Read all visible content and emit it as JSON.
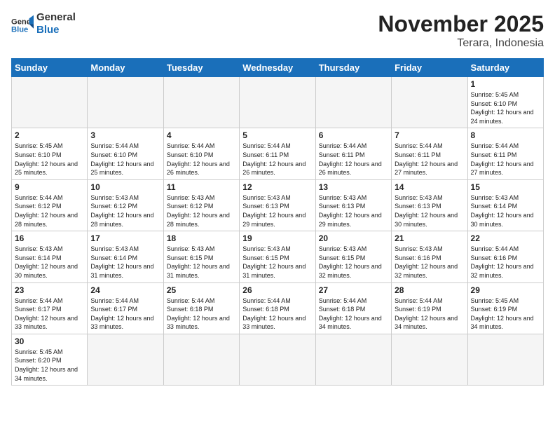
{
  "header": {
    "logo_general": "General",
    "logo_blue": "Blue",
    "title": "November 2025",
    "subtitle": "Terara, Indonesia"
  },
  "weekdays": [
    "Sunday",
    "Monday",
    "Tuesday",
    "Wednesday",
    "Thursday",
    "Friday",
    "Saturday"
  ],
  "weeks": [
    [
      {
        "day": "",
        "info": ""
      },
      {
        "day": "",
        "info": ""
      },
      {
        "day": "",
        "info": ""
      },
      {
        "day": "",
        "info": ""
      },
      {
        "day": "",
        "info": ""
      },
      {
        "day": "",
        "info": ""
      },
      {
        "day": "1",
        "info": "Sunrise: 5:45 AM\nSunset: 6:10 PM\nDaylight: 12 hours and 24 minutes."
      }
    ],
    [
      {
        "day": "2",
        "info": "Sunrise: 5:45 AM\nSunset: 6:10 PM\nDaylight: 12 hours and 25 minutes."
      },
      {
        "day": "3",
        "info": "Sunrise: 5:44 AM\nSunset: 6:10 PM\nDaylight: 12 hours and 25 minutes."
      },
      {
        "day": "4",
        "info": "Sunrise: 5:44 AM\nSunset: 6:10 PM\nDaylight: 12 hours and 26 minutes."
      },
      {
        "day": "5",
        "info": "Sunrise: 5:44 AM\nSunset: 6:11 PM\nDaylight: 12 hours and 26 minutes."
      },
      {
        "day": "6",
        "info": "Sunrise: 5:44 AM\nSunset: 6:11 PM\nDaylight: 12 hours and 26 minutes."
      },
      {
        "day": "7",
        "info": "Sunrise: 5:44 AM\nSunset: 6:11 PM\nDaylight: 12 hours and 27 minutes."
      },
      {
        "day": "8",
        "info": "Sunrise: 5:44 AM\nSunset: 6:11 PM\nDaylight: 12 hours and 27 minutes."
      }
    ],
    [
      {
        "day": "9",
        "info": "Sunrise: 5:44 AM\nSunset: 6:12 PM\nDaylight: 12 hours and 28 minutes."
      },
      {
        "day": "10",
        "info": "Sunrise: 5:43 AM\nSunset: 6:12 PM\nDaylight: 12 hours and 28 minutes."
      },
      {
        "day": "11",
        "info": "Sunrise: 5:43 AM\nSunset: 6:12 PM\nDaylight: 12 hours and 28 minutes."
      },
      {
        "day": "12",
        "info": "Sunrise: 5:43 AM\nSunset: 6:13 PM\nDaylight: 12 hours and 29 minutes."
      },
      {
        "day": "13",
        "info": "Sunrise: 5:43 AM\nSunset: 6:13 PM\nDaylight: 12 hours and 29 minutes."
      },
      {
        "day": "14",
        "info": "Sunrise: 5:43 AM\nSunset: 6:13 PM\nDaylight: 12 hours and 30 minutes."
      },
      {
        "day": "15",
        "info": "Sunrise: 5:43 AM\nSunset: 6:14 PM\nDaylight: 12 hours and 30 minutes."
      }
    ],
    [
      {
        "day": "16",
        "info": "Sunrise: 5:43 AM\nSunset: 6:14 PM\nDaylight: 12 hours and 30 minutes."
      },
      {
        "day": "17",
        "info": "Sunrise: 5:43 AM\nSunset: 6:14 PM\nDaylight: 12 hours and 31 minutes."
      },
      {
        "day": "18",
        "info": "Sunrise: 5:43 AM\nSunset: 6:15 PM\nDaylight: 12 hours and 31 minutes."
      },
      {
        "day": "19",
        "info": "Sunrise: 5:43 AM\nSunset: 6:15 PM\nDaylight: 12 hours and 31 minutes."
      },
      {
        "day": "20",
        "info": "Sunrise: 5:43 AM\nSunset: 6:15 PM\nDaylight: 12 hours and 32 minutes."
      },
      {
        "day": "21",
        "info": "Sunrise: 5:43 AM\nSunset: 6:16 PM\nDaylight: 12 hours and 32 minutes."
      },
      {
        "day": "22",
        "info": "Sunrise: 5:44 AM\nSunset: 6:16 PM\nDaylight: 12 hours and 32 minutes."
      }
    ],
    [
      {
        "day": "23",
        "info": "Sunrise: 5:44 AM\nSunset: 6:17 PM\nDaylight: 12 hours and 33 minutes."
      },
      {
        "day": "24",
        "info": "Sunrise: 5:44 AM\nSunset: 6:17 PM\nDaylight: 12 hours and 33 minutes."
      },
      {
        "day": "25",
        "info": "Sunrise: 5:44 AM\nSunset: 6:18 PM\nDaylight: 12 hours and 33 minutes."
      },
      {
        "day": "26",
        "info": "Sunrise: 5:44 AM\nSunset: 6:18 PM\nDaylight: 12 hours and 33 minutes."
      },
      {
        "day": "27",
        "info": "Sunrise: 5:44 AM\nSunset: 6:18 PM\nDaylight: 12 hours and 34 minutes."
      },
      {
        "day": "28",
        "info": "Sunrise: 5:44 AM\nSunset: 6:19 PM\nDaylight: 12 hours and 34 minutes."
      },
      {
        "day": "29",
        "info": "Sunrise: 5:45 AM\nSunset: 6:19 PM\nDaylight: 12 hours and 34 minutes."
      }
    ],
    [
      {
        "day": "30",
        "info": "Sunrise: 5:45 AM\nSunset: 6:20 PM\nDaylight: 12 hours and 34 minutes."
      },
      {
        "day": "",
        "info": ""
      },
      {
        "day": "",
        "info": ""
      },
      {
        "day": "",
        "info": ""
      },
      {
        "day": "",
        "info": ""
      },
      {
        "day": "",
        "info": ""
      },
      {
        "day": "",
        "info": ""
      }
    ]
  ]
}
